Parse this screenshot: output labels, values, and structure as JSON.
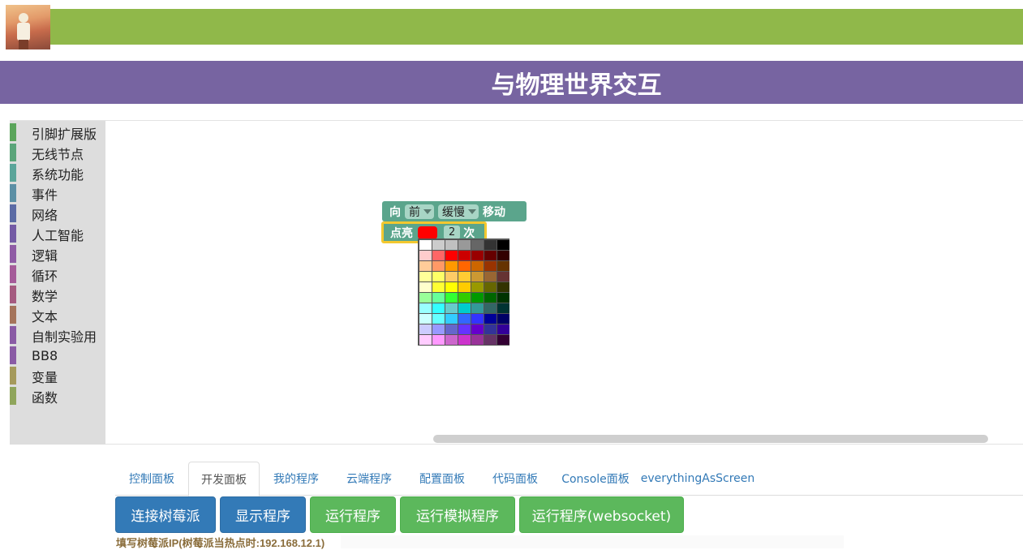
{
  "header": {
    "title": "与物理世界交互",
    "brand_color": "#90b84a",
    "title_bar_color": "#7764a1"
  },
  "toolbox": {
    "categories": [
      {
        "label": "引脚扩展版",
        "color": "#5ba55b"
      },
      {
        "label": "无线节点",
        "color": "#5ba57a"
      },
      {
        "label": "系统功能",
        "color": "#5ba59a"
      },
      {
        "label": "事件",
        "color": "#5b8fa5"
      },
      {
        "label": "网络",
        "color": "#5b6ba5"
      },
      {
        "label": "人工智能",
        "color": "#745ba5"
      },
      {
        "label": "逻辑",
        "color": "#8f5ba5"
      },
      {
        "label": "循环",
        "color": "#a55b99"
      },
      {
        "label": "数学",
        "color": "#a55b80"
      },
      {
        "label": "文本",
        "color": "#a5745b"
      },
      {
        "label": "自制实验用",
        "color": "#8a5ba5"
      },
      {
        "label": "BB8",
        "color": "#8a5ba5"
      },
      {
        "label": "变量",
        "color": "#a59a5b"
      },
      {
        "label": "函数",
        "color": "#8fa55b"
      }
    ]
  },
  "blocks": {
    "move": {
      "prefix": "向",
      "direction": "前",
      "speed": "缓慢",
      "suffix": "移动"
    },
    "light": {
      "prefix": "点亮",
      "color": "#ff0000",
      "count": "2",
      "suffix": "次"
    }
  },
  "color_palette": [
    [
      "#ffffff",
      "#cccccc",
      "#c0c0c0",
      "#999999",
      "#666666",
      "#333333",
      "#000000"
    ],
    [
      "#ffcccc",
      "#ff6666",
      "#ff0000",
      "#cc0000",
      "#990000",
      "#660000",
      "#330000"
    ],
    [
      "#ffcc99",
      "#ff9966",
      "#ff9900",
      "#ff6600",
      "#cc6600",
      "#993300",
      "#663300"
    ],
    [
      "#ffff99",
      "#ffff66",
      "#ffcc66",
      "#ffcc33",
      "#cc9933",
      "#996633",
      "#663333"
    ],
    [
      "#ffffcc",
      "#ffff33",
      "#ffff00",
      "#ffcc00",
      "#999900",
      "#666600",
      "#333300"
    ],
    [
      "#99ff99",
      "#66ff99",
      "#33ff33",
      "#33cc00",
      "#009900",
      "#006600",
      "#003300"
    ],
    [
      "#99ffff",
      "#33ffff",
      "#66cccc",
      "#00cccc",
      "#339999",
      "#336666",
      "#003333"
    ],
    [
      "#ccffff",
      "#66ffff",
      "#33ccff",
      "#3366ff",
      "#3333ff",
      "#000099",
      "#000066"
    ],
    [
      "#ccccff",
      "#9999ff",
      "#6666cc",
      "#6633ff",
      "#6600cc",
      "#333399",
      "#330099"
    ],
    [
      "#ffccff",
      "#ff99ff",
      "#cc66cc",
      "#cc33cc",
      "#993399",
      "#663366",
      "#330033"
    ]
  ],
  "tabs": [
    {
      "label": "控制面板",
      "active": false
    },
    {
      "label": "开发面板",
      "active": true
    },
    {
      "label": "我的程序",
      "active": false
    },
    {
      "label": "云端程序",
      "active": false
    },
    {
      "label": "配置面板",
      "active": false
    },
    {
      "label": "代码面板",
      "active": false
    },
    {
      "label": "Console面板",
      "active": false
    },
    {
      "label": "everythingAsScreen",
      "active": false
    }
  ],
  "buttons": [
    {
      "label": "连接树莓派",
      "style": "blue"
    },
    {
      "label": "显示程序",
      "style": "blue"
    },
    {
      "label": "运行程序",
      "style": "green"
    },
    {
      "label": "运行模拟程序",
      "style": "green"
    },
    {
      "label": "运行程序(websocket)",
      "style": "green"
    }
  ],
  "ip_label": "填写树莓派IP(树莓派当热点时:192.168.12.1)"
}
